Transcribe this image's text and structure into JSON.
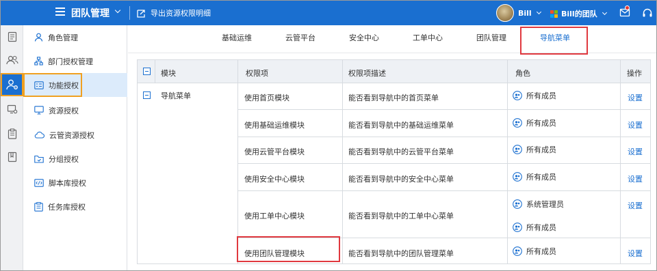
{
  "header": {
    "title": "团队管理",
    "export_label": "导出资源权限明细",
    "user_name": "Bill",
    "team_name": "Bill的团队",
    "brand_color": "#1a6fd0",
    "icons": [
      "menu-icon",
      "export-icon",
      "avatar",
      "chevron-down-icon",
      "team-grid-icon",
      "notification-icon",
      "headset-icon"
    ]
  },
  "rail": {
    "icons": [
      "document-icon",
      "users-icon",
      "user-settings-icon",
      "monitor-settings-icon",
      "clipboard-icon",
      "book-icon"
    ],
    "active_index": 2
  },
  "sidebar": {
    "items": [
      {
        "label": "角色管理",
        "icon": "user-icon"
      },
      {
        "label": "部门授权管理",
        "icon": "org-chart-icon"
      },
      {
        "label": "功能授权",
        "icon": "function-list-icon"
      },
      {
        "label": "资源授权",
        "icon": "monitor-icon"
      },
      {
        "label": "云管资源授权",
        "icon": "cloud-icon"
      },
      {
        "label": "分组授权",
        "icon": "folder-icon"
      },
      {
        "label": "脚本库授权",
        "icon": "script-icon"
      },
      {
        "label": "任务库授权",
        "icon": "task-icon"
      }
    ],
    "active_index": 2
  },
  "tabs": {
    "items": [
      "基础运维",
      "云管平台",
      "安全中心",
      "工单中心",
      "团队管理",
      "导航菜单"
    ],
    "active_index": 5
  },
  "table": {
    "headers": {
      "module": "模块",
      "permission": "权限项",
      "description": "权限项描述",
      "role": "角色",
      "action": "操作"
    },
    "module_name": "导航菜单",
    "rows": [
      {
        "permission": "使用首页模块",
        "description": "能否看到导航中的首页菜单",
        "roles": [
          "所有成员"
        ],
        "action": "设置"
      },
      {
        "permission": "使用基础运维模块",
        "description": "能否看到导航中的基础运维菜单",
        "roles": [
          "所有成员"
        ],
        "action": "设置"
      },
      {
        "permission": "使用云管平台模块",
        "description": "能否看到导航中的云管平台菜单",
        "roles": [
          "所有成员"
        ],
        "action": "设置"
      },
      {
        "permission": "使用安全中心模块",
        "description": "能否看到导航中的安全中心菜单",
        "roles": [
          "所有成员"
        ],
        "action": "设置"
      },
      {
        "permission": "使用工单中心模块",
        "description": "能否看到导航中的工单中心菜单",
        "roles": [
          "系统管理员",
          "所有成员"
        ],
        "action": "设置"
      },
      {
        "permission": "使用团队管理模块",
        "description": "能否看到导航中的团队管理菜单",
        "roles": [
          "所有成员"
        ],
        "action": "设置"
      }
    ]
  }
}
